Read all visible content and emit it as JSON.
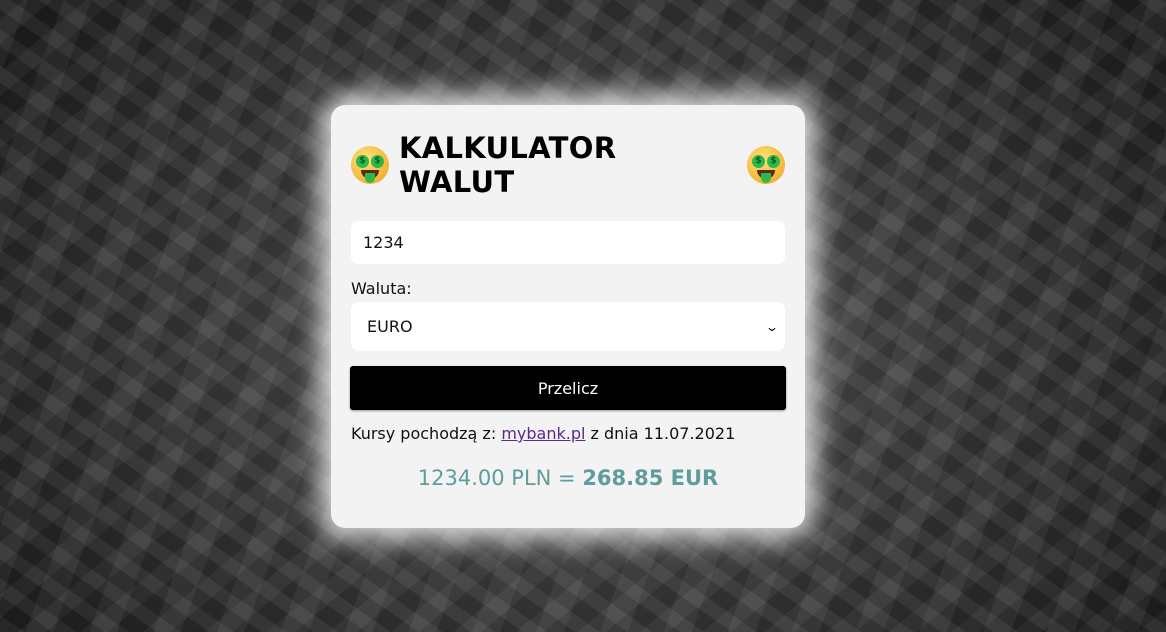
{
  "title": "KALKULATOR WALUT",
  "icons": {
    "title_emoji": "money-mouth-face-icon"
  },
  "form": {
    "amount_value": "1234",
    "currency_label": "Waluta:",
    "currency_selected": "EURO",
    "submit_label": "Przelicz"
  },
  "source": {
    "prefix": "Kursy pochodzą z:",
    "link_text": "mybank.pl",
    "suffix": "z dnia 11.07.2021"
  },
  "result": {
    "input_text": "1234.00 PLN =",
    "output_text": "268.85 EUR"
  },
  "colors": {
    "card_bg": "#f3f3f3",
    "button_bg": "#000000",
    "result_color": "#5f9c9c",
    "link_color": "#5b2a86"
  }
}
